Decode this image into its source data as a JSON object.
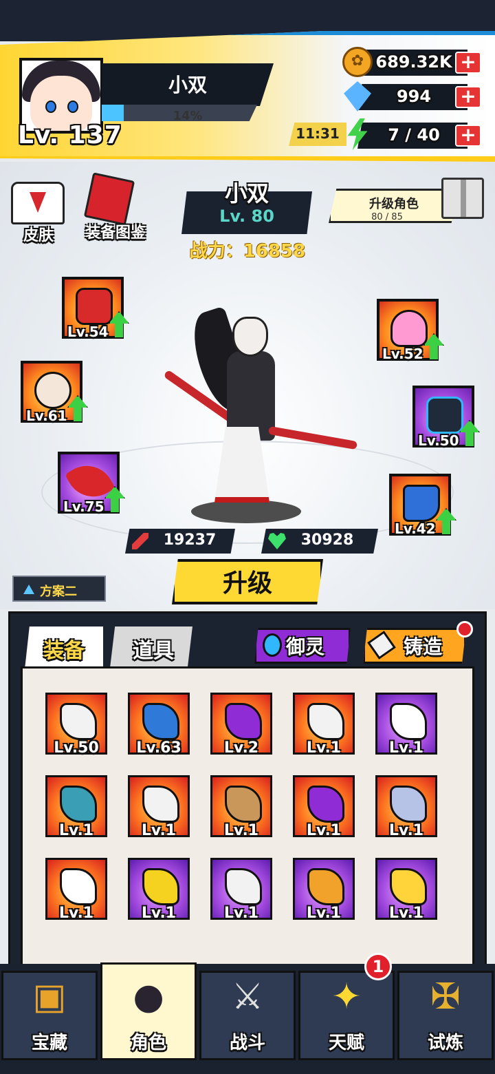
{
  "player": {
    "name": "小双",
    "level": "Lv. 137",
    "exp_percent": "14%",
    "exp_fraction": 0.14
  },
  "resources": {
    "coins": "689.32K",
    "gems": "994",
    "energy_timer": "11:31",
    "energy": "7 / 40",
    "plus": "+"
  },
  "left_buttons": {
    "skin": "皮肤",
    "codex": "装备图鉴"
  },
  "hero": {
    "name": "小双",
    "level": "Lv. 80",
    "power": "战力：16858",
    "upgrade_label": "升级角色",
    "upgrade_progress": "80 / 85",
    "attack": "19237",
    "hp": "30928"
  },
  "equipped": [
    {
      "level": "Lv.54",
      "upgradable": true
    },
    {
      "level": "Lv.61",
      "upgradable": true
    },
    {
      "level": "Lv.75",
      "upgradable": true
    },
    {
      "level": "Lv.52",
      "upgradable": true
    },
    {
      "level": "Lv.50",
      "upgradable": true
    },
    {
      "level": "Lv.42",
      "upgradable": true
    }
  ],
  "plan_label": "方案二",
  "upgrade_button": "升级",
  "tabs": {
    "equipment": "装备",
    "items": "道具",
    "spirit": "御灵",
    "forge": "铸造"
  },
  "inventory": [
    {
      "level": "Lv.50",
      "rarity": "orange",
      "icon": "blade-icon"
    },
    {
      "level": "Lv.63",
      "rarity": "orange",
      "icon": "sandal-icon"
    },
    {
      "level": "Lv.2",
      "rarity": "orange",
      "icon": "orb-necklace-icon"
    },
    {
      "level": "Lv.1",
      "rarity": "orange",
      "icon": "blade-icon"
    },
    {
      "level": "Lv.1",
      "rarity": "purple",
      "icon": "uniform-icon"
    },
    {
      "level": "Lv.1",
      "rarity": "orange",
      "icon": "jagged-blade-icon"
    },
    {
      "level": "Lv.1",
      "rarity": "orange",
      "icon": "blade-icon"
    },
    {
      "level": "Lv.1",
      "rarity": "orange",
      "icon": "ring-icon"
    },
    {
      "level": "Lv.1",
      "rarity": "orange",
      "icon": "orb-necklace-icon"
    },
    {
      "level": "Lv.1",
      "rarity": "orange",
      "icon": "crown-icon"
    },
    {
      "level": "Lv.1",
      "rarity": "orange",
      "icon": "uniform-icon"
    },
    {
      "level": "Lv.1",
      "rarity": "purple",
      "icon": "banana-blade-icon"
    },
    {
      "level": "Lv.1",
      "rarity": "purple",
      "icon": "blade-icon"
    },
    {
      "level": "Lv.1",
      "rarity": "purple",
      "icon": "dragon-ring-icon"
    },
    {
      "level": "Lv.1",
      "rarity": "purple",
      "icon": "gem-necklace-icon"
    }
  ],
  "nav": {
    "treasure": "宝藏",
    "character": "角色",
    "battle": "战斗",
    "talent": "天赋",
    "trial": "试炼",
    "talent_badge": "1"
  },
  "colors": {
    "accent_yellow": "#ffd933",
    "dark_panel": "#1a2230",
    "badge_red": "#e0202a",
    "upgrade_green": "#3cd045"
  }
}
